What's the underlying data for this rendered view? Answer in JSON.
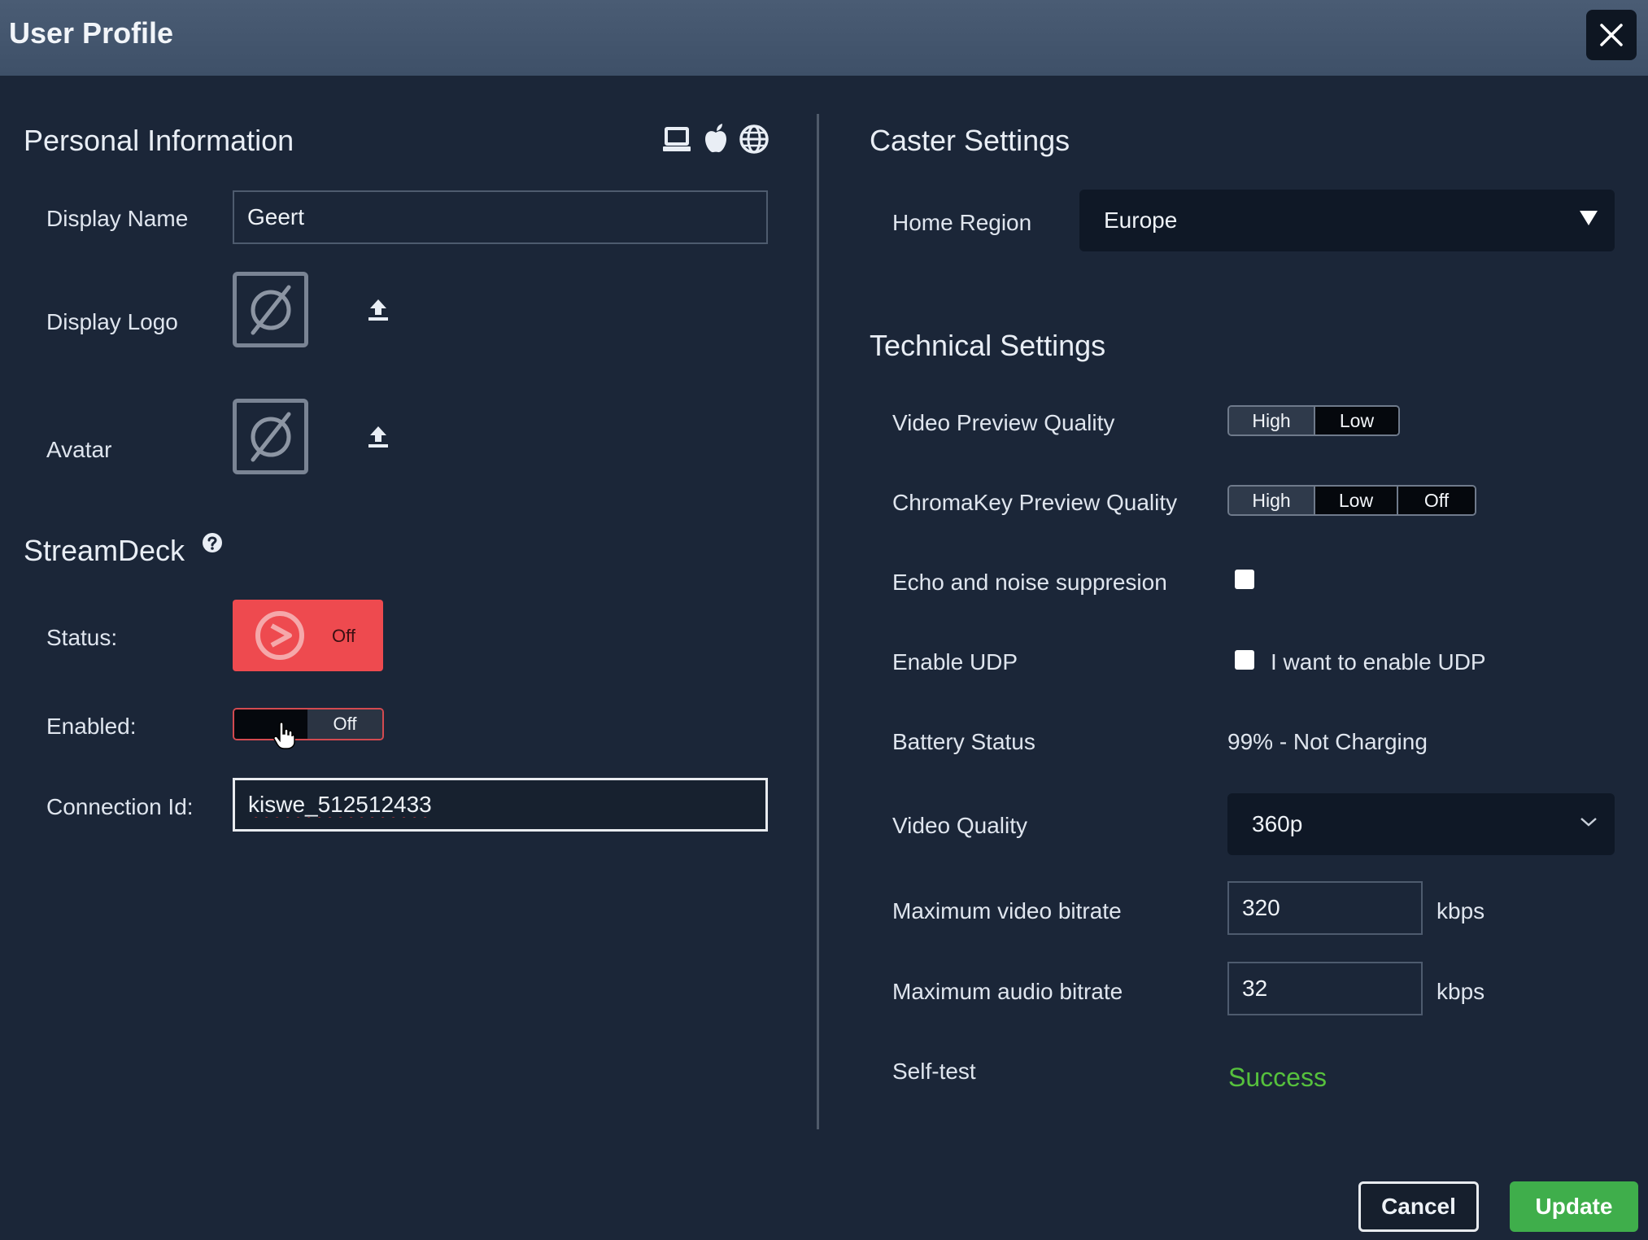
{
  "window": {
    "title": "User Profile"
  },
  "personal": {
    "heading": "Personal Information",
    "platform_icons": [
      "laptop-icon",
      "apple-icon",
      "globe-icon"
    ],
    "display_name_label": "Display Name",
    "display_name_value": "Geert",
    "display_logo_label": "Display Logo",
    "avatar_label": "Avatar"
  },
  "streamdeck": {
    "heading": "StreamDeck",
    "status_label": "Status:",
    "status_value": "Off",
    "enabled_label": "Enabled:",
    "enabled_value": "Off",
    "connection_label": "Connection Id:",
    "connection_value": "kiswe_512512433"
  },
  "caster": {
    "heading": "Caster Settings",
    "home_region_label": "Home Region",
    "home_region_value": "Europe"
  },
  "technical": {
    "heading": "Technical Settings",
    "video_preview_label": "Video Preview Quality",
    "video_preview_options": [
      "High",
      "Low"
    ],
    "video_preview_selected": "High",
    "chromakey_label": "ChromaKey Preview Quality",
    "chromakey_options": [
      "High",
      "Low",
      "Off"
    ],
    "chromakey_selected": "High",
    "echo_label": "Echo and noise suppresion",
    "echo_checked": false,
    "udp_label": "Enable UDP",
    "udp_checkbox_label": "I want to enable UDP",
    "udp_checked": false,
    "battery_label": "Battery Status",
    "battery_value": "99% - Not Charging",
    "video_quality_label": "Video Quality",
    "video_quality_value": "360p",
    "max_video_label": "Maximum video bitrate",
    "max_video_value": "320",
    "max_video_unit": "kbps",
    "max_audio_label": "Maximum audio bitrate",
    "max_audio_value": "32",
    "max_audio_unit": "kbps",
    "selftest_label": "Self-test",
    "selftest_value": "Success"
  },
  "footer": {
    "cancel_label": "Cancel",
    "update_label": "Update"
  },
  "colors": {
    "accent_green": "#3fae4b",
    "success_text": "#56c13d",
    "status_red": "#ee4a4f",
    "background": "#1b2638"
  }
}
